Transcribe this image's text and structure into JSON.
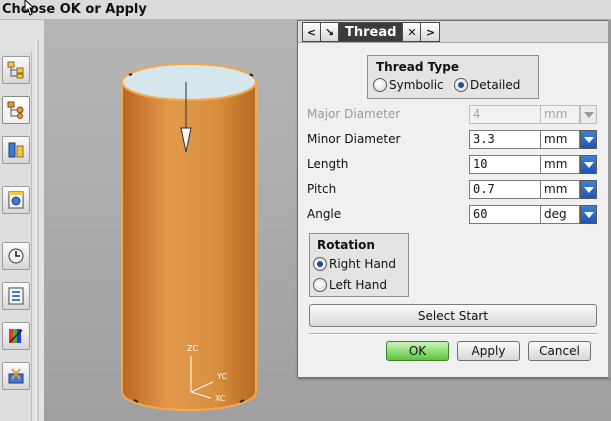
{
  "cue": {
    "text": "Choose OK or Apply"
  },
  "toolbar": {
    "buttons": [
      {
        "name": "assembly-navigator-icon",
        "top": 0
      },
      {
        "name": "part-navigator-icon",
        "top": 0
      },
      {
        "name": "constraint-navigator-icon",
        "top": 0
      },
      {
        "name": "web-browser-icon",
        "top": 0
      },
      {
        "name": "history-icon",
        "top": 0
      },
      {
        "name": "system-materials-icon",
        "top": 0
      },
      {
        "name": "roles-icon",
        "top": 0
      },
      {
        "name": "assembly-load-icon",
        "top": 0
      }
    ]
  },
  "viewport": {
    "axes": {
      "zc": "ZC",
      "yc": "YC",
      "xc": "XC"
    },
    "colors": {
      "cylinder_body": "#d88f3e",
      "cylinder_top": "#d5e6ec",
      "highlight": "#f5a74a"
    }
  },
  "dialog": {
    "title": "Thread",
    "title_buttons": {
      "back": "<",
      "collapse": "↘",
      "close": "✕",
      "forward": ">"
    },
    "thread_type": {
      "title": "Thread Type",
      "options": [
        {
          "label": "Symbolic",
          "selected": false
        },
        {
          "label": "Detailed",
          "selected": true
        }
      ]
    },
    "fields": [
      {
        "label": "Major Diameter",
        "value": "4",
        "unit": "mm",
        "enabled": false
      },
      {
        "label": "Minor Diameter",
        "value": "3.3",
        "unit": "mm",
        "enabled": true
      },
      {
        "label": "Length",
        "value": "10",
        "unit": "mm",
        "enabled": true
      },
      {
        "label": "Pitch",
        "value": "0.7",
        "unit": "mm",
        "enabled": true
      },
      {
        "label": "Angle",
        "value": "60",
        "unit": "deg",
        "enabled": true
      }
    ],
    "rotation": {
      "title": "Rotation",
      "options": [
        {
          "label": "Right Hand",
          "selected": true
        },
        {
          "label": "Left Hand",
          "selected": false
        }
      ]
    },
    "select_start": "Select Start",
    "ok": "OK",
    "apply": "Apply",
    "cancel": "Cancel"
  }
}
